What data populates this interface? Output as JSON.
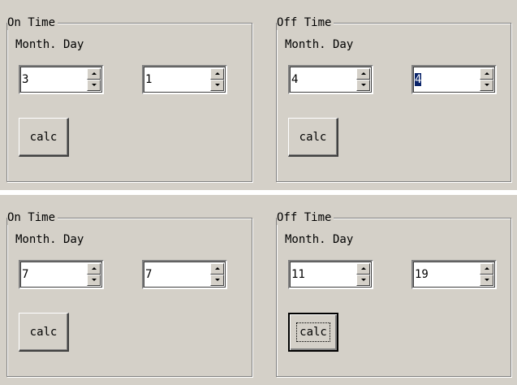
{
  "panels": [
    {
      "on": {
        "legend": "On Time",
        "label": "Month. Day",
        "month": "3",
        "day": "1",
        "button": "calc"
      },
      "off": {
        "legend": "Off Time",
        "label": "Month. Day",
        "month": "4",
        "day": "4",
        "button": "calc"
      }
    },
    {
      "on": {
        "legend": "On Time",
        "label": "Month. Day",
        "month": "7",
        "day": "7",
        "button": "calc"
      },
      "off": {
        "legend": "Off Time",
        "label": "Month. Day",
        "month": "11",
        "day": "19",
        "button": "calc"
      }
    }
  ],
  "colors": {
    "face": "#d4d0c8",
    "selection": "#0a246a"
  },
  "icons": {
    "spin_up": "up-arrow-icon",
    "spin_down": "down-arrow-icon"
  }
}
